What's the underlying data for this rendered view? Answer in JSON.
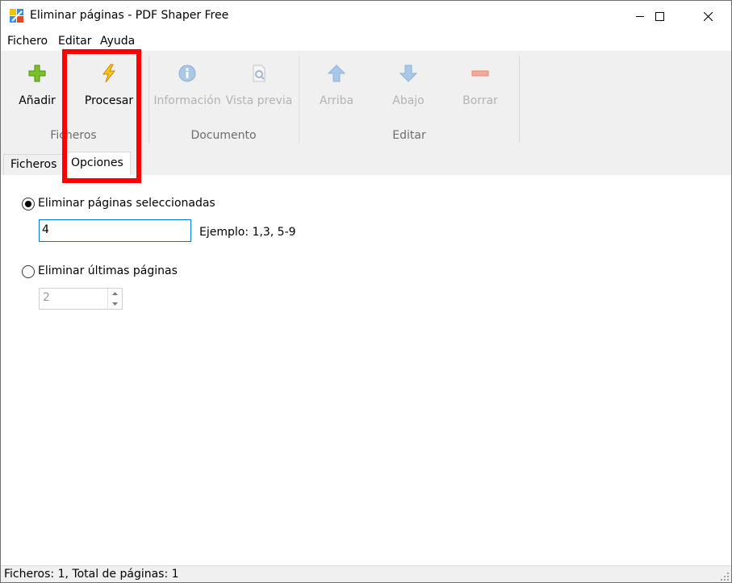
{
  "window": {
    "title": "Eliminar páginas - PDF Shaper Free",
    "app_icon": "pdf-shaper-icon",
    "controls": [
      "minimize-icon",
      "maximize-icon",
      "close-icon"
    ]
  },
  "menu": [
    "Fichero",
    "Editar",
    "Ayuda"
  ],
  "ribbon": {
    "groups": [
      "Ficheros",
      "Documento",
      "Editar"
    ],
    "buttons": [
      {
        "label": "Añadir",
        "icon": "add-icon",
        "enabled": true
      },
      {
        "label": "Procesar",
        "icon": "lightning-icon",
        "enabled": true
      },
      {
        "label": "Información",
        "icon": "info-icon",
        "enabled": false
      },
      {
        "label": "Vista previa",
        "icon": "preview-icon",
        "enabled": false
      },
      {
        "label": "Arriba",
        "icon": "arrow-up-icon",
        "enabled": false
      },
      {
        "label": "Abajo",
        "icon": "arrow-down-icon",
        "enabled": false
      },
      {
        "label": "Borrar",
        "icon": "minus-icon",
        "enabled": false
      }
    ]
  },
  "tabs": [
    {
      "label": "Ficheros",
      "active": false
    },
    {
      "label": "Opciones",
      "active": true
    }
  ],
  "options": {
    "remove_selected": {
      "label": "Eliminar páginas seleccionadas",
      "checked": true,
      "value": "4",
      "hint": "Ejemplo: 1,3, 5-9"
    },
    "remove_last": {
      "label": "Eliminar últimas páginas",
      "checked": false,
      "value": "2"
    }
  },
  "status": "Ficheros: 1, Total de páginas: 1",
  "colors": {
    "highlight": "#ff0000",
    "focus_border": "#0078d7"
  }
}
